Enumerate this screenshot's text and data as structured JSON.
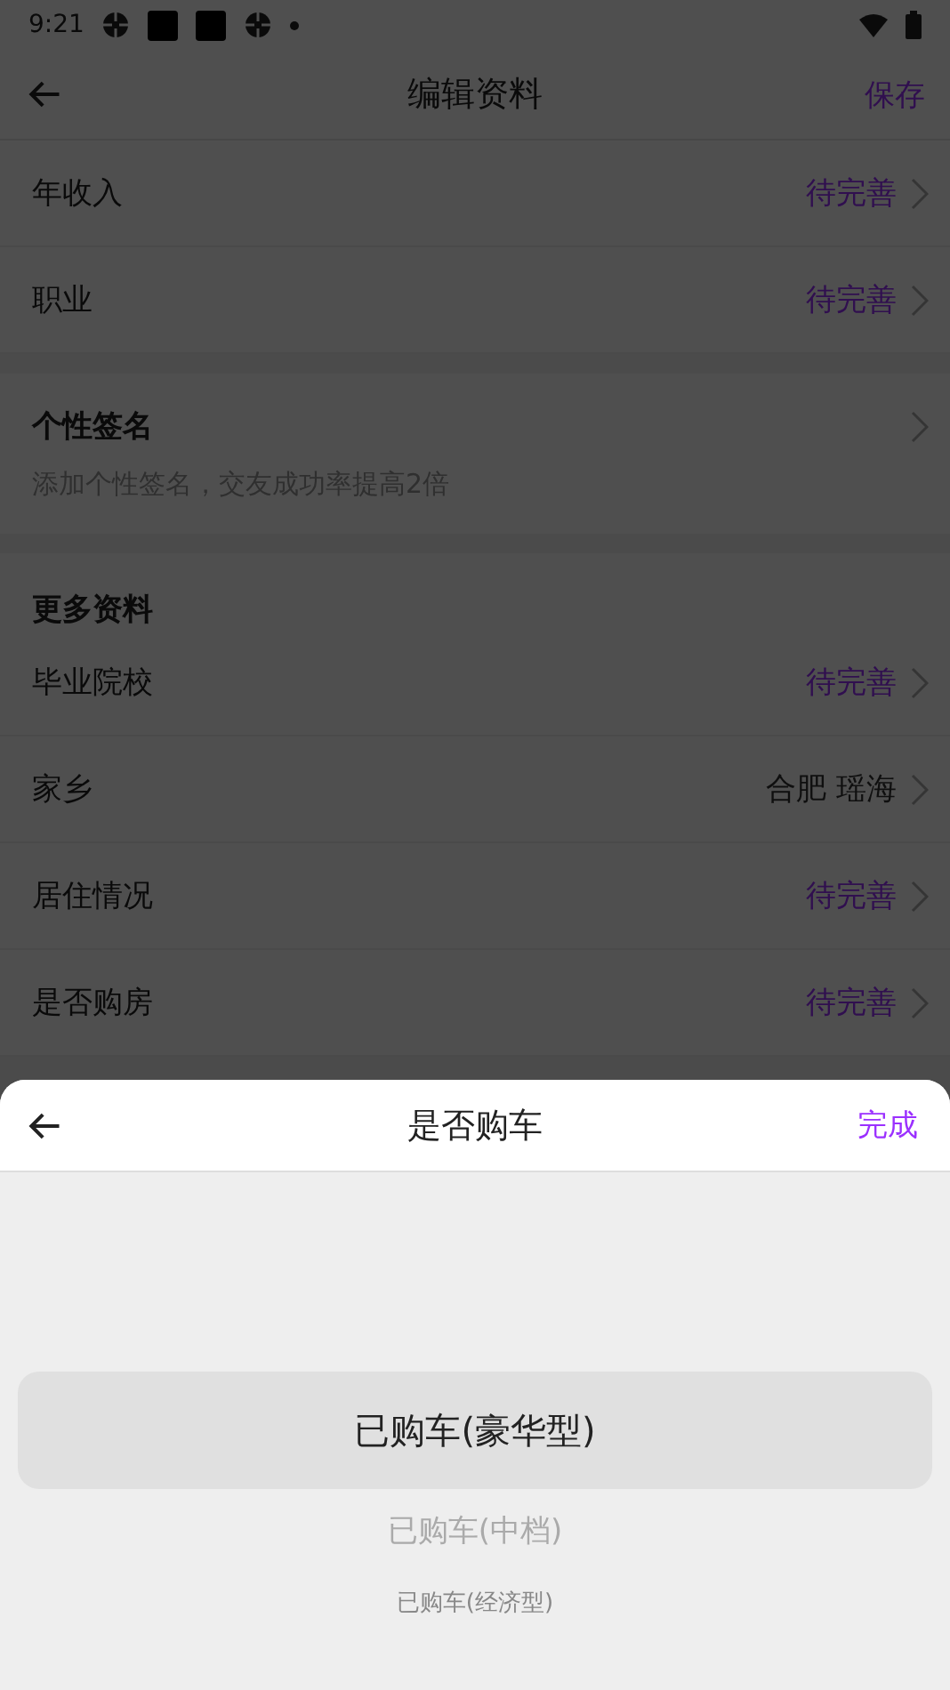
{
  "status_bar": {
    "time": "9:21"
  },
  "header": {
    "title": "编辑资料",
    "action": "保存"
  },
  "basic_rows": [
    {
      "label": "年收入",
      "value": "待完善",
      "filled": false
    },
    {
      "label": "职业",
      "value": "待完善",
      "filled": false
    }
  ],
  "signature": {
    "title": "个性签名",
    "hint": "添加个性签名，交友成功率提高2倍"
  },
  "more": {
    "title": "更多资料",
    "rows": [
      {
        "label": "毕业院校",
        "value": "待完善",
        "filled": false
      },
      {
        "label": "家乡",
        "value": "合肥 瑶海",
        "filled": true
      },
      {
        "label": "居住情况",
        "value": "待完善",
        "filled": false
      },
      {
        "label": "是否购房",
        "value": "待完善",
        "filled": false
      }
    ]
  },
  "sheet": {
    "title": "是否购车",
    "done": "完成",
    "options": [
      {
        "label": "已购车(豪华型)",
        "selected": true
      },
      {
        "label": "已购车(中档)",
        "selected": false
      },
      {
        "label": "已购车(经济型)",
        "selected": false
      }
    ]
  }
}
